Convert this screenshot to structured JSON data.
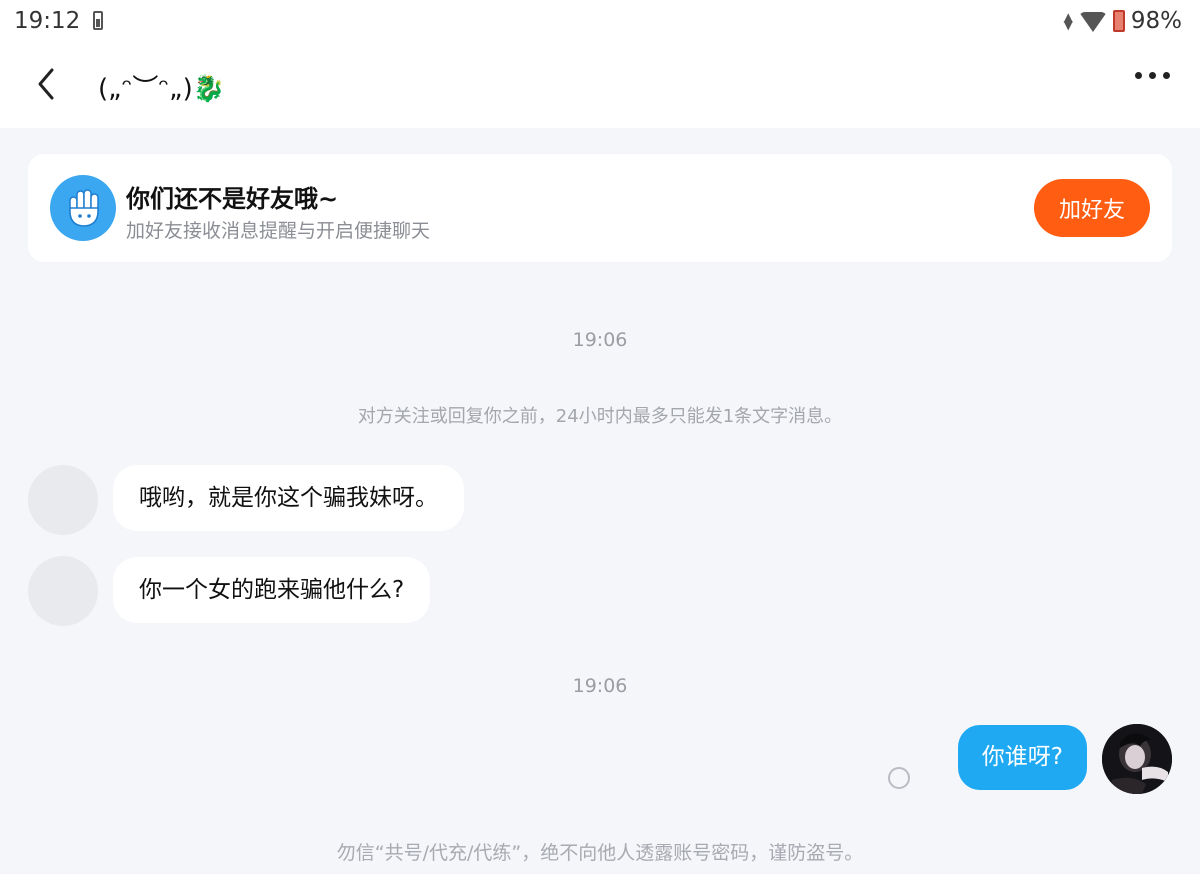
{
  "status_bar": {
    "time": "19:12",
    "battery": "98%",
    "icons": [
      "battery-small-icon",
      "data-arrows-icon",
      "wifi-icon",
      "battery-low-red-icon"
    ]
  },
  "header": {
    "title": "(„ᵔ︶ᵔ„)",
    "title_emoji": "🐉",
    "back_icon": "chevron-left-icon",
    "more_icon": "more-dots-icon"
  },
  "friend_card": {
    "title": "你们还不是好友哦~",
    "subtitle": "加好友接收消息提醒与开启便捷聊天",
    "button_label": "加好友",
    "icon": "waving-hand-icon",
    "button_color": "#ff5d12"
  },
  "chat": {
    "time_1": "19:06",
    "notice": "对方关注或回复你之前，24小时内最多只能发1条文字消息。",
    "messages": [
      {
        "from": "other",
        "text": "哦哟，就是你这个骗我妹呀。"
      },
      {
        "from": "other",
        "text": "你一个女的跑来骗他什么?"
      },
      {
        "from": "me",
        "text": "你谁呀?"
      }
    ],
    "time_2": "19:06",
    "my_bubble_color": "#1ea9f2"
  },
  "footer": {
    "warning": "勿信“共号/代充/代练”，绝不向他人透露账号密码，谨防盗号。"
  }
}
